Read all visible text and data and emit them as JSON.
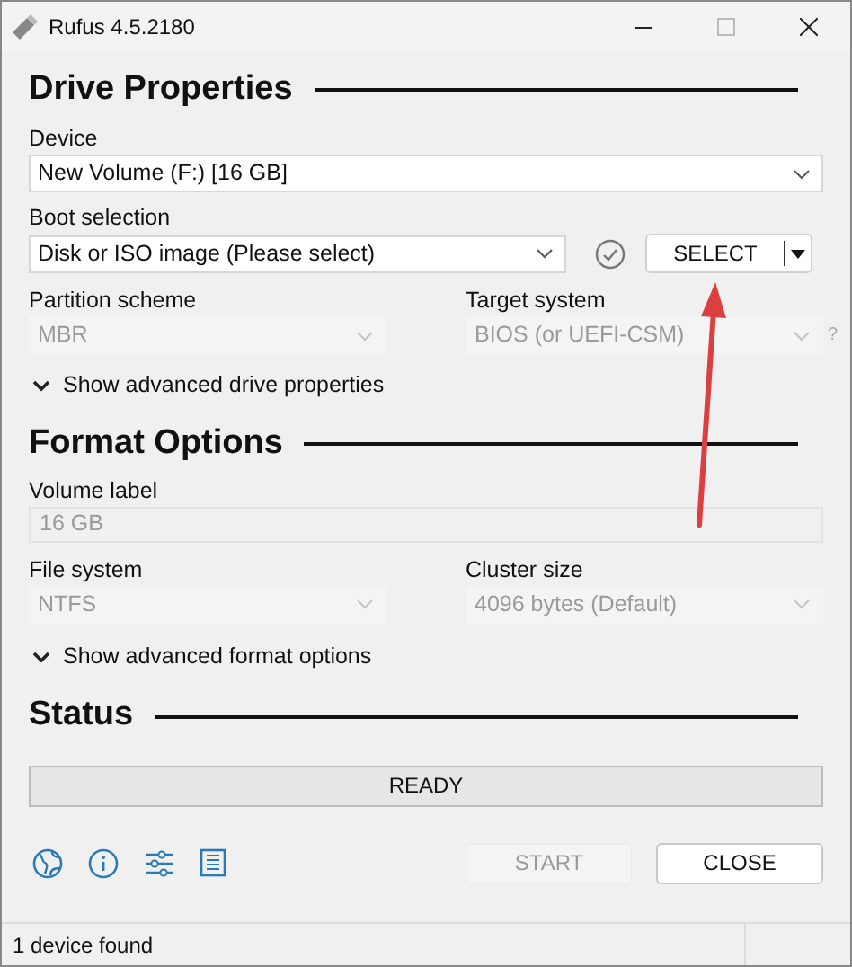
{
  "window": {
    "title": "Rufus 4.5.2180"
  },
  "sections": [
    {
      "heading": "Drive Properties"
    },
    {
      "heading": "Format Options"
    },
    {
      "heading": "Status"
    }
  ],
  "device": {
    "label": "Device",
    "value": "New Volume (F:) [16 GB]",
    "disabled": false
  },
  "boot_selection": {
    "label": "Boot selection",
    "value": "Disk or ISO image (Please select)",
    "disabled": false,
    "select_button": "SELECT"
  },
  "partition_scheme": {
    "label": "Partition scheme",
    "value": "MBR",
    "disabled": true
  },
  "target_system": {
    "label": "Target system",
    "value": "BIOS (or UEFI-CSM)",
    "disabled": true,
    "help": "?"
  },
  "advanced_drive": {
    "label": "Show advanced drive properties",
    "expanded": false
  },
  "volume_label": {
    "label": "Volume label",
    "value": "16 GB",
    "disabled": true
  },
  "file_system": {
    "label": "File system",
    "value": "NTFS",
    "disabled": true
  },
  "cluster_size": {
    "label": "Cluster size",
    "value": "4096 bytes (Default)",
    "disabled": true
  },
  "advanced_format": {
    "label": "Show advanced format options",
    "expanded": false
  },
  "status": {
    "text": "READY"
  },
  "buttons": [
    {
      "label": "START",
      "disabled": true
    },
    {
      "label": "CLOSE",
      "disabled": false
    }
  ],
  "status_bar": {
    "text": "1 device found"
  }
}
